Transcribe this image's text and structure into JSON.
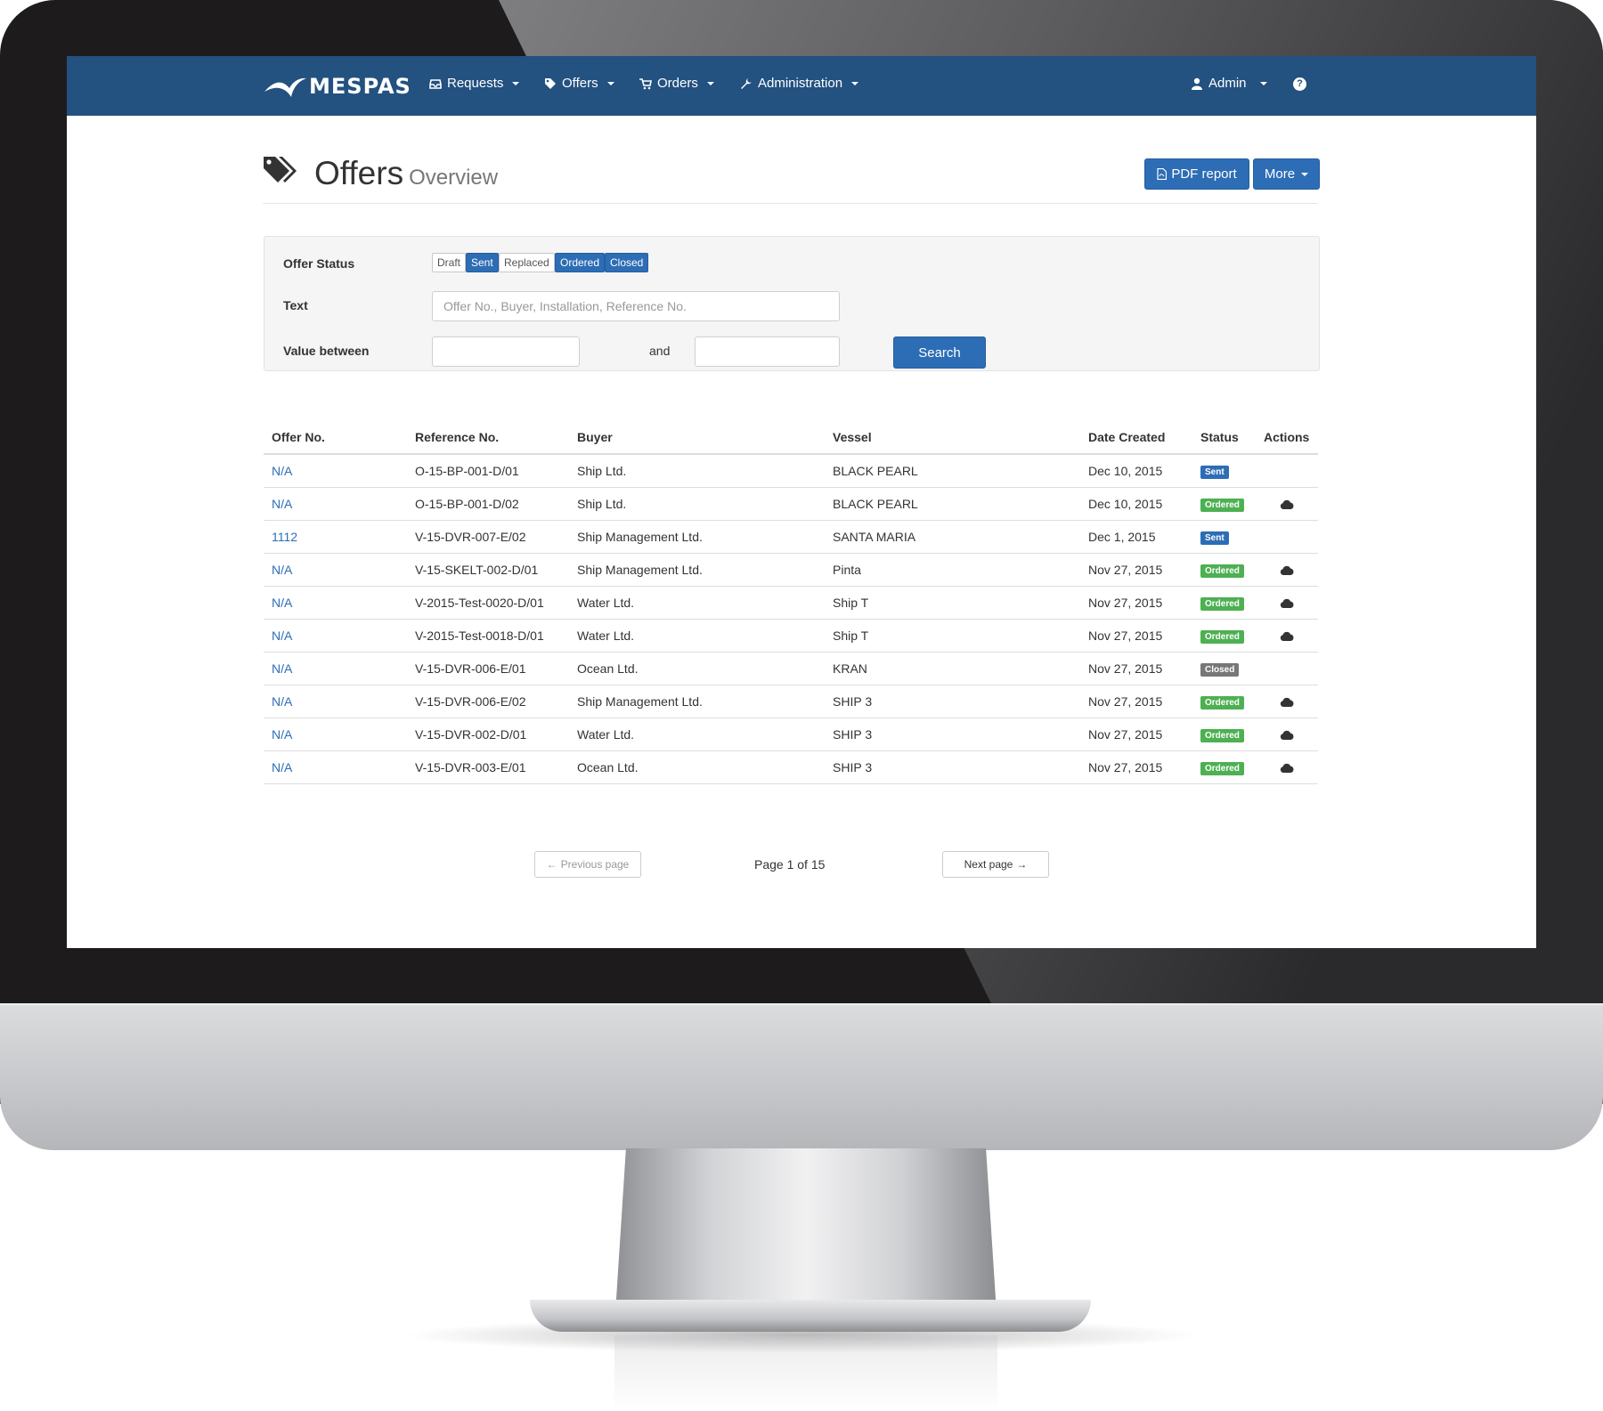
{
  "navbar": {
    "brand": "MESPAS",
    "items": [
      {
        "label": "Requests",
        "icon": "inbox-icon"
      },
      {
        "label": "Offers",
        "icon": "tag-icon"
      },
      {
        "label": "Orders",
        "icon": "cart-icon"
      },
      {
        "label": "Administration",
        "icon": "wrench-icon"
      }
    ],
    "user": {
      "label": "Admin",
      "icon": "user-icon"
    },
    "help_icon": "question-circle-icon",
    "help_glyph": "?",
    "color": "#235180"
  },
  "page": {
    "title": "Offers",
    "subtitle": "Overview",
    "icon": "tags-icon",
    "pdf_button": "PDF report",
    "more_button": "More"
  },
  "filter": {
    "status_label": "Offer Status",
    "statuses": [
      {
        "label": "Draft",
        "active": false
      },
      {
        "label": "Sent",
        "active": true
      },
      {
        "label": "Replaced",
        "active": false
      },
      {
        "label": "Ordered",
        "active": true
      },
      {
        "label": "Closed",
        "active": true
      }
    ],
    "text_label": "Text",
    "text_placeholder": "Offer No., Buyer, Installation, Reference No.",
    "value_label": "Value between",
    "and_label": "and",
    "value_from": "",
    "value_to": "",
    "search_button": "Search"
  },
  "table": {
    "columns": [
      "Offer No.",
      "Reference No.",
      "Buyer",
      "Vessel",
      "Date Created",
      "Status",
      "Actions"
    ],
    "rows": [
      {
        "offer_no": "N/A",
        "reference": "O-15-BP-001-D/01",
        "buyer": "Ship Ltd.",
        "vessel": "BLACK PEARL",
        "date": "Dec 10, 2015",
        "status": "Sent",
        "action_icon": ""
      },
      {
        "offer_no": "N/A",
        "reference": "O-15-BP-001-D/02",
        "buyer": "Ship Ltd.",
        "vessel": "BLACK PEARL",
        "date": "Dec 10, 2015",
        "status": "Ordered",
        "action_icon": "cloud-icon"
      },
      {
        "offer_no": "1112",
        "reference": "V-15-DVR-007-E/02",
        "buyer": "Ship Management Ltd.",
        "vessel": "SANTA MARIA",
        "date": "Dec 1, 2015",
        "status": "Sent",
        "action_icon": ""
      },
      {
        "offer_no": "N/A",
        "reference": "V-15-SKELT-002-D/01",
        "buyer": "Ship Management Ltd.",
        "vessel": "Pinta",
        "date": "Nov 27, 2015",
        "status": "Ordered",
        "action_icon": "cloud-icon"
      },
      {
        "offer_no": "N/A",
        "reference": "V-2015-Test-0020-D/01",
        "buyer": "Water Ltd.",
        "vessel": "Ship T",
        "date": "Nov 27, 2015",
        "status": "Ordered",
        "action_icon": "cloud-icon"
      },
      {
        "offer_no": "N/A",
        "reference": "V-2015-Test-0018-D/01",
        "buyer": "Water Ltd.",
        "vessel": "Ship T",
        "date": "Nov 27, 2015",
        "status": "Ordered",
        "action_icon": "cloud-icon"
      },
      {
        "offer_no": "N/A",
        "reference": "V-15-DVR-006-E/01",
        "buyer": "Ocean Ltd.",
        "vessel": "KRAN",
        "date": "Nov 27, 2015",
        "status": "Closed",
        "action_icon": ""
      },
      {
        "offer_no": "N/A",
        "reference": "V-15-DVR-006-E/02",
        "buyer": "Ship Management Ltd.",
        "vessel": "SHIP 3",
        "date": "Nov 27, 2015",
        "status": "Ordered",
        "action_icon": "cloud-icon"
      },
      {
        "offer_no": "N/A",
        "reference": "V-15-DVR-002-D/01",
        "buyer": "Water Ltd.",
        "vessel": "SHIP 3",
        "date": "Nov 27, 2015",
        "status": "Ordered",
        "action_icon": "cloud-icon"
      },
      {
        "offer_no": "N/A",
        "reference": "V-15-DVR-003-E/01",
        "buyer": "Ocean Ltd.",
        "vessel": "SHIP 3",
        "date": "Nov 27, 2015",
        "status": "Ordered",
        "action_icon": "cloud-icon"
      }
    ]
  },
  "pagination": {
    "previous": "Previous page",
    "info": "Page 1 of 15",
    "next": "Next page"
  },
  "colors": {
    "primary": "#2d6db5",
    "ordered": "#4db052",
    "closed": "#777777"
  }
}
